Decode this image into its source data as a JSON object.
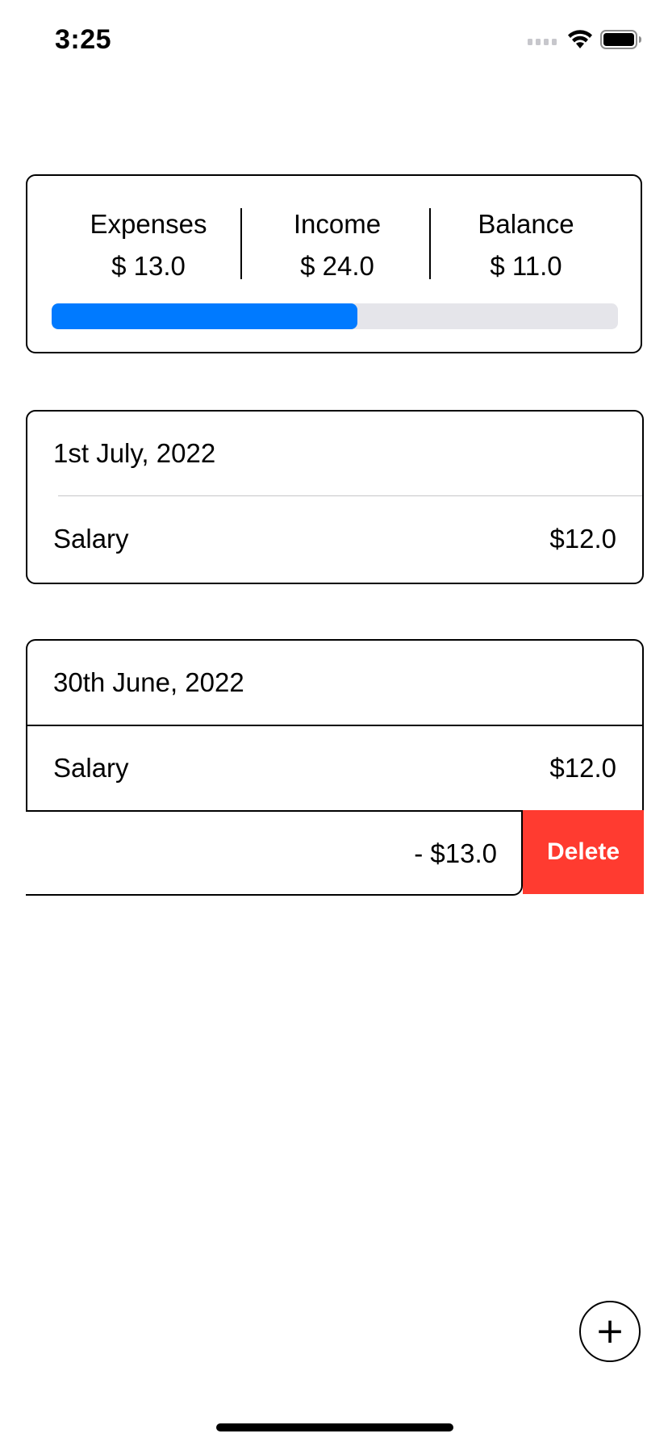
{
  "status_bar": {
    "time": "3:25"
  },
  "summary": {
    "expenses_label": "Expenses",
    "expenses_value": "$ 13.0",
    "income_label": "Income",
    "income_value": "$ 24.0",
    "balance_label": "Balance",
    "balance_value": "$ 11.0",
    "progress_fraction": 0.54,
    "progress_color": "#007aff",
    "progress_track_color": "#e5e5ea"
  },
  "days": [
    {
      "date": "1st July, 2022",
      "rows": [
        {
          "label": "Salary",
          "amount": "$12.0"
        }
      ]
    },
    {
      "date": "30th June, 2022",
      "rows": [
        {
          "label": "Salary",
          "amount": "$12.0"
        },
        {
          "label": "",
          "amount": "- $13.0",
          "swiped": true
        }
      ]
    }
  ],
  "swipe_action": {
    "delete_label": "Delete",
    "color": "#ff3b30"
  },
  "fab": {
    "icon": "plus-icon",
    "glyph": "+"
  }
}
